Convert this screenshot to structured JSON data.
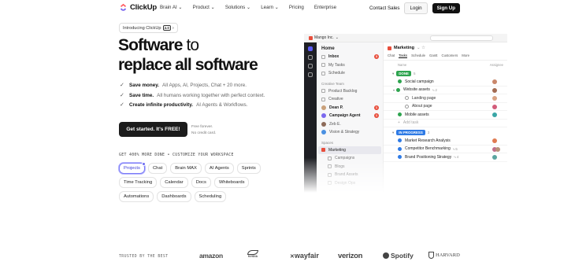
{
  "nav": {
    "logo": "ClickUp",
    "links": [
      "Brain AI",
      "Product",
      "Solutions",
      "Learn",
      "Pricing",
      "Enterprise"
    ],
    "contact_sales": "Contact Sales",
    "login": "Login",
    "signup": "Sign Up"
  },
  "hero": {
    "badge_text": "Introducing ClickUp",
    "badge_version": "4.0",
    "headline_line1_bold": "Software",
    "headline_line1_light": "to",
    "headline_line2": "replace all software",
    "features": [
      {
        "bold": "Save money.",
        "rest": "All Apps, AI, Projects, Chat + 20 more."
      },
      {
        "bold": "Save time.",
        "rest": "All humans working together with perfect context."
      },
      {
        "bold": "Create infinite productivity.",
        "rest": "AI Agents & Workflows."
      }
    ],
    "cta": "Get started. It's FREE!",
    "cta_note_1": "Free forever.",
    "cta_note_2": "No credit card.",
    "customize": "GET 400% MORE DONE • CUSTOMIZE YOUR WORKSPACE",
    "chips": [
      [
        "Projects",
        "Chat",
        "Brain MAX",
        "AI Agents",
        "Sprints"
      ],
      [
        "Time Tracking",
        "Calendar",
        "Docs",
        "Whiteboards"
      ],
      [
        "Automations",
        "Dashboards",
        "Scheduling"
      ]
    ]
  },
  "app": {
    "workspace": "Mango Inc.",
    "sidebar_title": "Home",
    "nav_items": [
      {
        "label": "Inbox",
        "count": "3"
      },
      {
        "label": "My Tasks"
      },
      {
        "label": "Schedule"
      }
    ],
    "section_creative": "Creative Team",
    "creative_items": [
      "Product Backlog",
      "Creative"
    ],
    "people": [
      {
        "label": "Dean P.",
        "count": "1"
      },
      {
        "label": "Campaign Agent",
        "count": "1"
      },
      {
        "label": "Zeb E."
      }
    ],
    "vision": "Vision & Strategy",
    "section_spaces": "Spaces",
    "space_items": [
      "Marketing",
      "Campaigns",
      "Blogs",
      "Brand Assets",
      "Design Ops"
    ],
    "main_title": "Marketing",
    "tabs": [
      "Chat",
      "Tasks",
      "Schedule",
      "Gantt",
      "Customers",
      "More"
    ],
    "col_name": "Name",
    "col_assignee": "Assignee",
    "group_done": {
      "label": "DONE",
      "count": "5"
    },
    "done_tasks": [
      {
        "name": "Social campaign"
      },
      {
        "name": "Website assets",
        "meta": "2"
      },
      {
        "name": "Landing page"
      },
      {
        "name": "About page"
      },
      {
        "name": "Mobile assets"
      }
    ],
    "add_task": "Add task",
    "group_progress": {
      "label": "IN PROGRESS",
      "count": "3"
    },
    "progress_tasks": [
      {
        "name": "Market Research Analysis"
      },
      {
        "name": "Competitor Benchmarking",
        "meta": "5"
      },
      {
        "name": "Brand Positioning Strategy",
        "meta": "4"
      }
    ]
  },
  "trusted": {
    "label": "TRUSTED BY THE BEST",
    "brands": [
      "amazon",
      "NVIDIA",
      "wayfair",
      "verizon",
      "Spotify",
      "HARVARD"
    ]
  }
}
